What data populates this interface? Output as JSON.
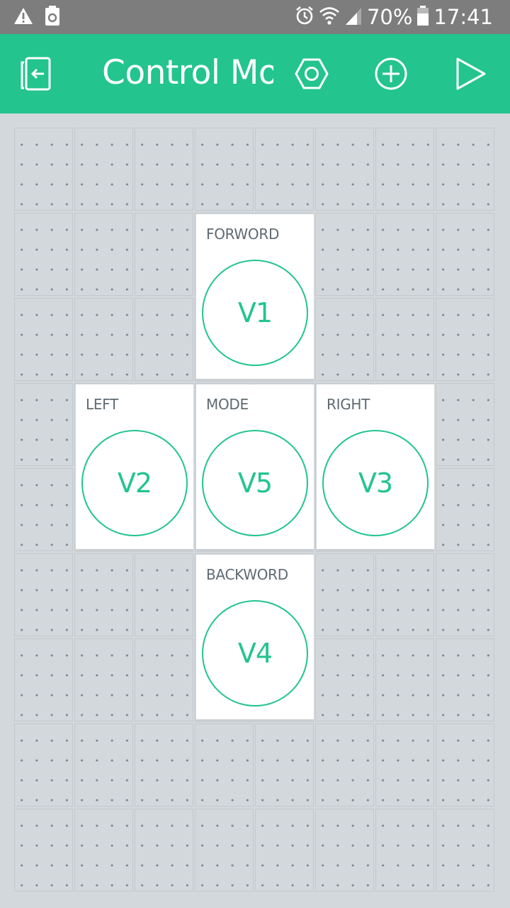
{
  "status_bar": {
    "battery_percent": "70%",
    "time": "17:41",
    "icons": [
      "warning-icon",
      "recycle-icon",
      "alarm-icon",
      "wifi-icon",
      "signal-icon",
      "battery-icon"
    ]
  },
  "app_bar": {
    "title": "Control Motor",
    "icons": [
      "exit-project-icon",
      "settings-hex-icon",
      "add-widget-icon",
      "play-icon"
    ]
  },
  "colors": {
    "accent": "#23c48e",
    "status_bar": "#7d7d7d",
    "canvas": "#d3d8dc",
    "widget_bg": "#ffffff",
    "label_text": "#5f6a72"
  },
  "widgets": [
    {
      "id": "forword",
      "label": "FORWORD",
      "pin": "V1"
    },
    {
      "id": "left",
      "label": "LEFT",
      "pin": "V2"
    },
    {
      "id": "mode",
      "label": "MODE",
      "pin": "V5"
    },
    {
      "id": "right",
      "label": "RIGHT",
      "pin": "V3"
    },
    {
      "id": "backword",
      "label": "BACKWORD",
      "pin": "V4"
    }
  ]
}
